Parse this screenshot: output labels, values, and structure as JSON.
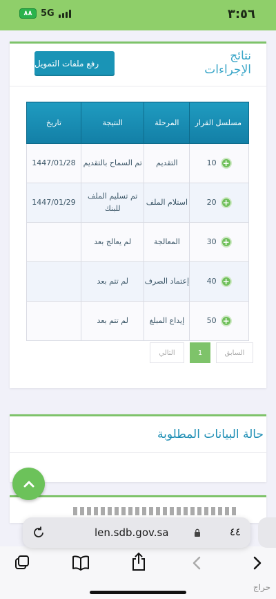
{
  "status_bar": {
    "time": "٣:٥٦",
    "battery": "٨٨",
    "network": "5G"
  },
  "card1": {
    "title": "نتائج الإجراءات",
    "upload_label": "رفع ملفات التمويل",
    "table": {
      "headers": [
        "مسلسل القرار",
        "المرحلة",
        "النتيجة",
        "تاريخ"
      ],
      "rows": [
        {
          "serial": "10",
          "stage": "التقديم",
          "result": "تم السماح بالتقديم",
          "date": "1447/01/28"
        },
        {
          "serial": "20",
          "stage": "استلام الملف",
          "result": "تم تسليم الملف للبنك",
          "date": "1447/01/29"
        },
        {
          "serial": "30",
          "stage": "المعالجة",
          "result": "لم يعالج بعد",
          "date": ""
        },
        {
          "serial": "40",
          "stage": "إعتماد الصرف",
          "result": "لم تتم بعد",
          "date": ""
        },
        {
          "serial": "50",
          "stage": "إيداع المبلغ",
          "result": "لم تتم بعد",
          "date": ""
        }
      ]
    },
    "pagination": {
      "prev_label": "السابق",
      "current_page": "1",
      "next_label": "التالي"
    }
  },
  "card2": {
    "title": "حالة البيانات المطلوبة"
  },
  "browser": {
    "url": "len.sdb.gov.sa",
    "aa_label": "٤٤"
  },
  "watermark": "حراج"
}
